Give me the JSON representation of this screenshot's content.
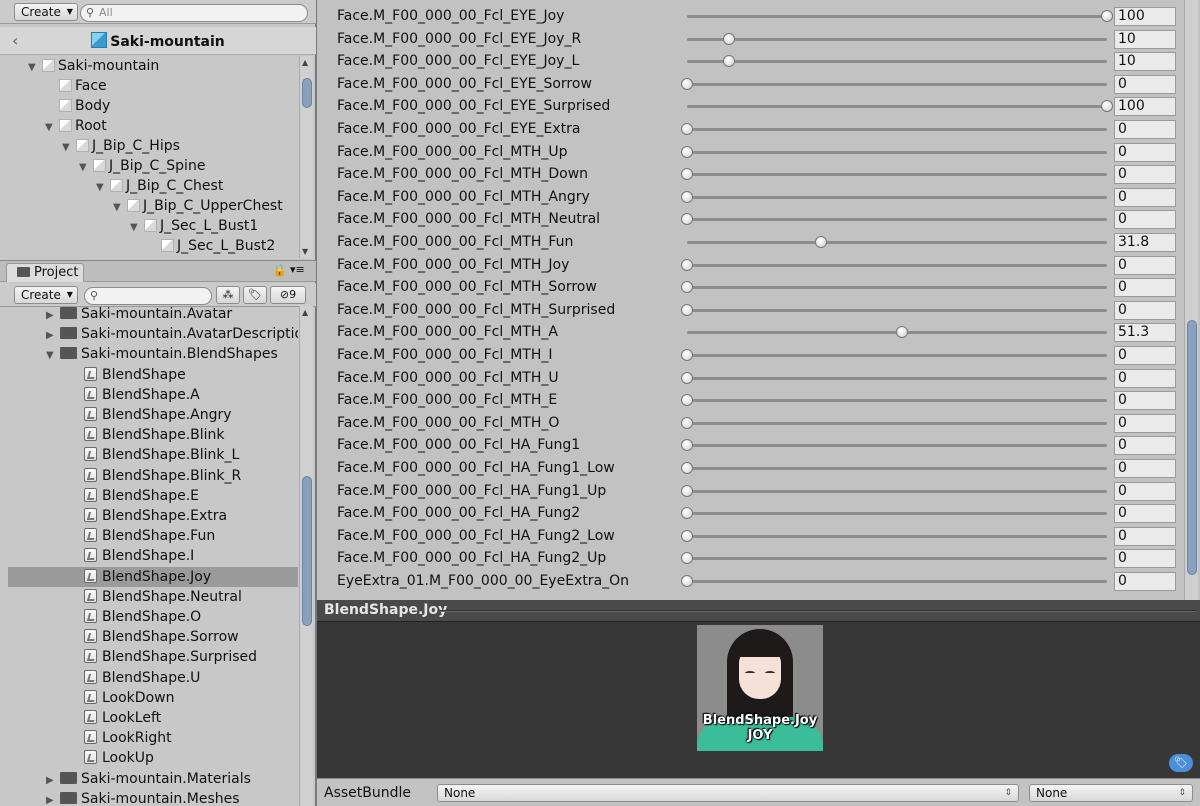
{
  "hierarchy": {
    "create_label": "Create",
    "search_placeholder": "All",
    "scene_title": "Saki-mountain",
    "items": [
      {
        "label": "Saki-mountain",
        "depth": 0,
        "arrow": "▼"
      },
      {
        "label": "Face",
        "depth": 1,
        "arrow": ""
      },
      {
        "label": "Body",
        "depth": 1,
        "arrow": ""
      },
      {
        "label": "Root",
        "depth": 1,
        "arrow": "▼"
      },
      {
        "label": "J_Bip_C_Hips",
        "depth": 2,
        "arrow": "▼"
      },
      {
        "label": "J_Bip_C_Spine",
        "depth": 3,
        "arrow": "▼"
      },
      {
        "label": "J_Bip_C_Chest",
        "depth": 4,
        "arrow": "▼"
      },
      {
        "label": "J_Bip_C_UpperChest",
        "depth": 5,
        "arrow": "▼"
      },
      {
        "label": "J_Sec_L_Bust1",
        "depth": 6,
        "arrow": "▼"
      },
      {
        "label": "J_Sec_L_Bust2",
        "depth": 7,
        "arrow": ""
      }
    ]
  },
  "project": {
    "tab_label": "Project",
    "create_label": "Create",
    "hidden_count": "9",
    "folders_top": [
      {
        "label": "Saki-mountain.Avatar",
        "arrow": "▶"
      },
      {
        "label": "Saki-mountain.AvatarDescriptio",
        "arrow": "▶"
      },
      {
        "label": "Saki-mountain.BlendShapes",
        "arrow": "▼"
      }
    ],
    "assets": [
      "BlendShape",
      "BlendShape.A",
      "BlendShape.Angry",
      "BlendShape.Blink",
      "BlendShape.Blink_L",
      "BlendShape.Blink_R",
      "BlendShape.E",
      "BlendShape.Extra",
      "BlendShape.Fun",
      "BlendShape.I",
      "BlendShape.Joy",
      "BlendShape.Neutral",
      "BlendShape.O",
      "BlendShape.Sorrow",
      "BlendShape.Surprised",
      "BlendShape.U",
      "LookDown",
      "LookLeft",
      "LookRight",
      "LookUp"
    ],
    "selected_asset": "BlendShape.Joy",
    "folders_bottom": [
      {
        "label": "Saki-mountain.Materials",
        "arrow": "▶"
      },
      {
        "label": "Saki-mountain.Meshes",
        "arrow": "▶"
      }
    ]
  },
  "blendshapes": [
    {
      "name": "Face.M_F00_000_00_Fcl_EYE_Joy",
      "value": "100",
      "fraction": 1.0
    },
    {
      "name": "Face.M_F00_000_00_Fcl_EYE_Joy_R",
      "value": "10",
      "fraction": 0.1
    },
    {
      "name": "Face.M_F00_000_00_Fcl_EYE_Joy_L",
      "value": "10",
      "fraction": 0.1
    },
    {
      "name": "Face.M_F00_000_00_Fcl_EYE_Sorrow",
      "value": "0",
      "fraction": 0
    },
    {
      "name": "Face.M_F00_000_00_Fcl_EYE_Surprised",
      "value": "100",
      "fraction": 1.0
    },
    {
      "name": "Face.M_F00_000_00_Fcl_EYE_Extra",
      "value": "0",
      "fraction": 0
    },
    {
      "name": "Face.M_F00_000_00_Fcl_MTH_Up",
      "value": "0",
      "fraction": 0
    },
    {
      "name": "Face.M_F00_000_00_Fcl_MTH_Down",
      "value": "0",
      "fraction": 0
    },
    {
      "name": "Face.M_F00_000_00_Fcl_MTH_Angry",
      "value": "0",
      "fraction": 0
    },
    {
      "name": "Face.M_F00_000_00_Fcl_MTH_Neutral",
      "value": "0",
      "fraction": 0
    },
    {
      "name": "Face.M_F00_000_00_Fcl_MTH_Fun",
      "value": "31.8",
      "fraction": 0.318
    },
    {
      "name": "Face.M_F00_000_00_Fcl_MTH_Joy",
      "value": "0",
      "fraction": 0
    },
    {
      "name": "Face.M_F00_000_00_Fcl_MTH_Sorrow",
      "value": "0",
      "fraction": 0
    },
    {
      "name": "Face.M_F00_000_00_Fcl_MTH_Surprised",
      "value": "0",
      "fraction": 0
    },
    {
      "name": "Face.M_F00_000_00_Fcl_MTH_A",
      "value": "51.3",
      "fraction": 0.513
    },
    {
      "name": "Face.M_F00_000_00_Fcl_MTH_I",
      "value": "0",
      "fraction": 0
    },
    {
      "name": "Face.M_F00_000_00_Fcl_MTH_U",
      "value": "0",
      "fraction": 0
    },
    {
      "name": "Face.M_F00_000_00_Fcl_MTH_E",
      "value": "0",
      "fraction": 0
    },
    {
      "name": "Face.M_F00_000_00_Fcl_MTH_O",
      "value": "0",
      "fraction": 0
    },
    {
      "name": "Face.M_F00_000_00_Fcl_HA_Fung1",
      "value": "0",
      "fraction": 0
    },
    {
      "name": "Face.M_F00_000_00_Fcl_HA_Fung1_Low",
      "value": "0",
      "fraction": 0
    },
    {
      "name": "Face.M_F00_000_00_Fcl_HA_Fung1_Up",
      "value": "0",
      "fraction": 0
    },
    {
      "name": "Face.M_F00_000_00_Fcl_HA_Fung2",
      "value": "0",
      "fraction": 0
    },
    {
      "name": "Face.M_F00_000_00_Fcl_HA_Fung2_Low",
      "value": "0",
      "fraction": 0
    },
    {
      "name": "Face.M_F00_000_00_Fcl_HA_Fung2_Up",
      "value": "0",
      "fraction": 0
    },
    {
      "name": "EyeExtra_01.M_F00_000_00_EyeExtra_On",
      "value": "0",
      "fraction": 0
    }
  ],
  "preview": {
    "title": "BlendShape.Joy",
    "thumb_line1": "BlendShape.Joy",
    "thumb_line2": "JOY"
  },
  "assetbundle": {
    "label": "AssetBundle",
    "name_value": "None",
    "variant_value": "None"
  },
  "colors": {
    "panel_bg": "#c2c2c2",
    "preview_bg": "#373737",
    "selection": "#9b9b9b",
    "scroll_thumb": "#8aa0bd",
    "accent_blue": "#4b8fd8"
  }
}
